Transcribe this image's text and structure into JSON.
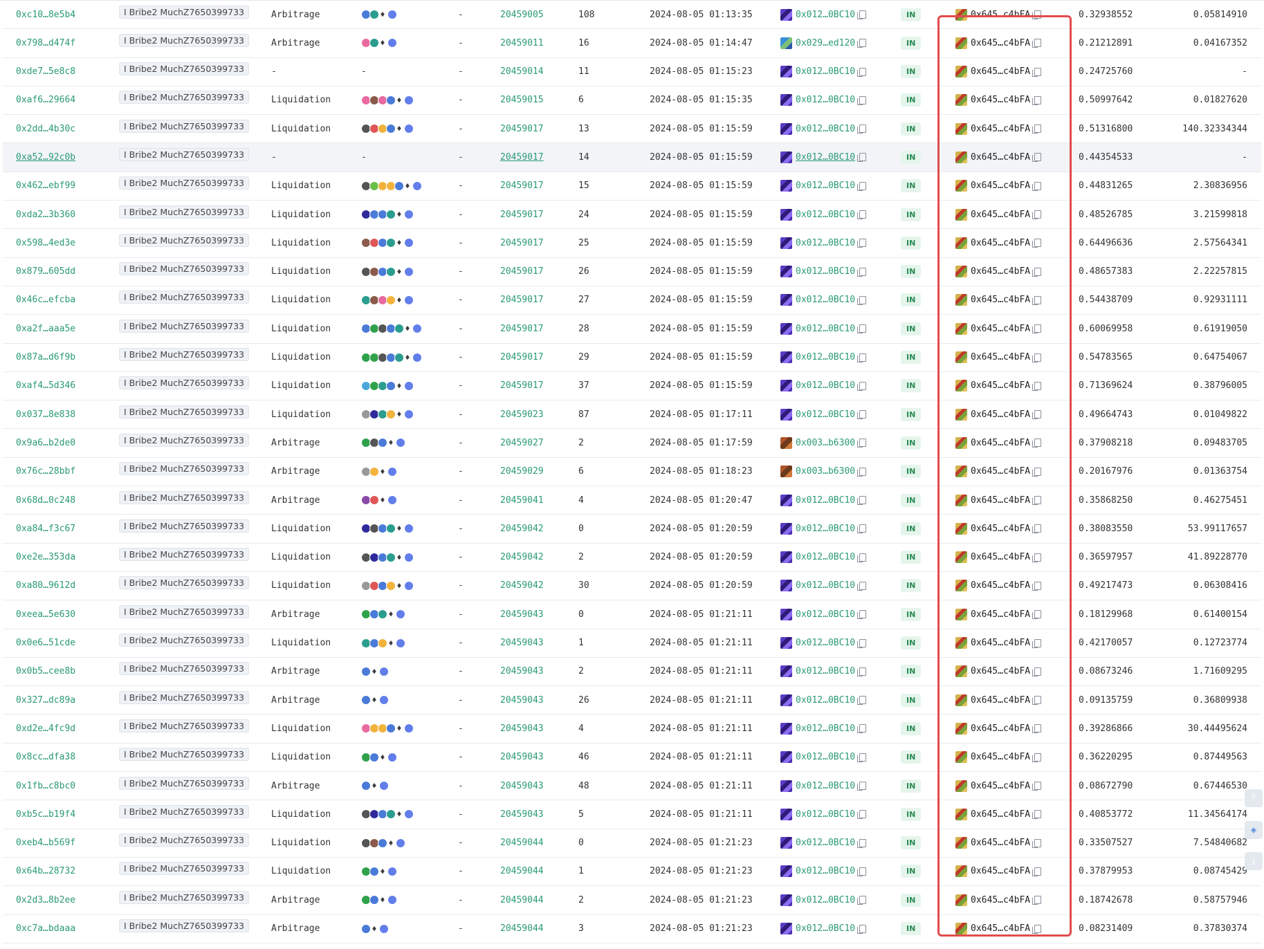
{
  "table": {
    "rows": [
      {
        "hash": "0xc10…8e5b4",
        "tag": "I Bribe2 MuchZ7650399733",
        "type": "Arbitrage",
        "tokens": [
          "#4a7bd8",
          "#2a9d8f",
          "eth",
          "#627eea"
        ],
        "dash": "-",
        "block": "20459005",
        "pos": "108",
        "time": "2024-08-05 01:13:35",
        "from": "0x012…0BC10",
        "from_avatar": "purple",
        "dir": "IN",
        "to": "0x645…c4bFA",
        "value1": "0.32938552",
        "value2": "0.05814910"
      },
      {
        "hash": "0x798…d474f",
        "tag": "I Bribe2 MuchZ7650399733",
        "type": "Arbitrage",
        "tokens": [
          "#e86aa0",
          "#2a9d8f",
          "eth",
          "#627eea"
        ],
        "dash": "-",
        "block": "20459011",
        "pos": "16",
        "time": "2024-08-05 01:14:47",
        "from": "0x029…ed120",
        "from_avatar": "blue",
        "dir": "IN",
        "to": "0x645…c4bFA",
        "value1": "0.21212891",
        "value2": "0.04167352"
      },
      {
        "hash": "0xde7…5e8c8",
        "tag": "I Bribe2 MuchZ7650399733",
        "type": "-",
        "tokens": [],
        "tokens_dash": "-",
        "dash": "-",
        "block": "20459014",
        "pos": "11",
        "time": "2024-08-05 01:15:23",
        "from": "0x012…0BC10",
        "from_avatar": "purple",
        "dir": "IN",
        "to": "0x645…c4bFA",
        "value1": "0.24725760",
        "value2": "-"
      },
      {
        "hash": "0xaf6…29664",
        "tag": "I Bribe2 MuchZ7650399733",
        "type": "Liquidation",
        "tokens": [
          "#e86aa0",
          "#8b5a4a",
          "#e86aa0",
          "#4a7bd8",
          "eth",
          "#627eea"
        ],
        "dash": "-",
        "block": "20459015",
        "pos": "6",
        "time": "2024-08-05 01:15:35",
        "from": "0x012…0BC10",
        "from_avatar": "purple",
        "dir": "IN",
        "to": "0x645…c4bFA",
        "value1": "0.50997642",
        "value2": "0.01827620"
      },
      {
        "hash": "0x2dd…4b30c",
        "tag": "I Bribe2 MuchZ7650399733",
        "type": "Liquidation",
        "tokens": [
          "#555",
          "#e05555",
          "#f2b33d",
          "#4a7bd8",
          "eth",
          "#627eea"
        ],
        "dash": "-",
        "block": "20459017",
        "pos": "13",
        "time": "2024-08-05 01:15:59",
        "from": "0x012…0BC10",
        "from_avatar": "purple",
        "dir": "IN",
        "to": "0x645…c4bFA",
        "value1": "0.51316800",
        "value2": "140.32334344"
      },
      {
        "hash": "0xa52…92c0b",
        "tag": "I Bribe2 MuchZ7650399733",
        "type": "-",
        "tokens": [],
        "tokens_dash": "-",
        "dash": "-",
        "block": "20459017",
        "pos": "14",
        "time": "2024-08-05 01:15:59",
        "from": "0x012…0BC10",
        "from_avatar": "purple",
        "dir": "IN",
        "to": "0x645…c4bFA",
        "value1": "0.44354533",
        "value2": "-",
        "hover": true
      },
      {
        "hash": "0x462…ebf99",
        "tag": "I Bribe2 MuchZ7650399733",
        "type": "Liquidation",
        "tokens": [
          "#555",
          "#6cbf4a",
          "#f2b33d",
          "#f2b33d",
          "#4a7bd8",
          "eth",
          "#627eea"
        ],
        "dash": "-",
        "block": "20459017",
        "pos": "15",
        "time": "2024-08-05 01:15:59",
        "from": "0x012…0BC10",
        "from_avatar": "purple",
        "dir": "IN",
        "to": "0x645…c4bFA",
        "value1": "0.44831265",
        "value2": "2.30836956"
      },
      {
        "hash": "0xda2…3b360",
        "tag": "I Bribe2 MuchZ7650399733",
        "type": "Liquidation",
        "tokens": [
          "#2e2a9c",
          "#4a7bd8",
          "#4a7bd8",
          "#2a9d8f",
          "eth",
          "#627eea"
        ],
        "dash": "-",
        "block": "20459017",
        "pos": "24",
        "time": "2024-08-05 01:15:59",
        "from": "0x012…0BC10",
        "from_avatar": "purple",
        "dir": "IN",
        "to": "0x645…c4bFA",
        "value1": "0.48526785",
        "value2": "3.21599818"
      },
      {
        "hash": "0x598…4ed3e",
        "tag": "I Bribe2 MuchZ7650399733",
        "type": "Liquidation",
        "tokens": [
          "#8b5a4a",
          "#e05555",
          "#4a7bd8",
          "#2a9d8f",
          "eth",
          "#627eea"
        ],
        "dash": "-",
        "block": "20459017",
        "pos": "25",
        "time": "2024-08-05 01:15:59",
        "from": "0x012…0BC10",
        "from_avatar": "purple",
        "dir": "IN",
        "to": "0x645…c4bFA",
        "value1": "0.64496636",
        "value2": "2.57564341"
      },
      {
        "hash": "0x879…605dd",
        "tag": "I Bribe2 MuchZ7650399733",
        "type": "Liquidation",
        "tokens": [
          "#555",
          "#8b5a4a",
          "#4a7bd8",
          "#2a9d8f",
          "eth",
          "#627eea"
        ],
        "dash": "-",
        "block": "20459017",
        "pos": "26",
        "time": "2024-08-05 01:15:59",
        "from": "0x012…0BC10",
        "from_avatar": "purple",
        "dir": "IN",
        "to": "0x645…c4bFA",
        "value1": "0.48657383",
        "value2": "2.22257815"
      },
      {
        "hash": "0x46c…efcba",
        "tag": "I Bribe2 MuchZ7650399733",
        "type": "Liquidation",
        "tokens": [
          "#2a9d8f",
          "#8b5a4a",
          "#e86aa0",
          "#f2b33d",
          "eth",
          "#627eea"
        ],
        "dash": "-",
        "block": "20459017",
        "pos": "27",
        "time": "2024-08-05 01:15:59",
        "from": "0x012…0BC10",
        "from_avatar": "purple",
        "dir": "IN",
        "to": "0x645…c4bFA",
        "value1": "0.54438709",
        "value2": "0.92931111"
      },
      {
        "hash": "0xa2f…aaa5e",
        "tag": "I Bribe2 MuchZ7650399733",
        "type": "Liquidation",
        "tokens": [
          "#4a7bd8",
          "#2fa14a",
          "#555",
          "#4a7bd8",
          "#2a9d8f",
          "eth",
          "#627eea"
        ],
        "dash": "-",
        "block": "20459017",
        "pos": "28",
        "time": "2024-08-05 01:15:59",
        "from": "0x012…0BC10",
        "from_avatar": "purple",
        "dir": "IN",
        "to": "0x645…c4bFA",
        "value1": "0.60069958",
        "value2": "0.61919050"
      },
      {
        "hash": "0x87a…d6f9b",
        "tag": "I Bribe2 MuchZ7650399733",
        "type": "Liquidation",
        "tokens": [
          "#2fa14a",
          "#2fa14a",
          "#555",
          "#4a7bd8",
          "#2a9d8f",
          "eth",
          "#627eea"
        ],
        "dash": "-",
        "block": "20459017",
        "pos": "29",
        "time": "2024-08-05 01:15:59",
        "from": "0x012…0BC10",
        "from_avatar": "purple",
        "dir": "IN",
        "to": "0x645…c4bFA",
        "value1": "0.54783565",
        "value2": "0.64754067"
      },
      {
        "hash": "0xaf4…5d346",
        "tag": "I Bribe2 MuchZ7650399733",
        "type": "Liquidation",
        "tokens": [
          "#4aa8d8",
          "#2fa14a",
          "#2a9d8f",
          "#4a7bd8",
          "eth",
          "#627eea"
        ],
        "dash": "-",
        "block": "20459017",
        "pos": "37",
        "time": "2024-08-05 01:15:59",
        "from": "0x012…0BC10",
        "from_avatar": "purple",
        "dir": "IN",
        "to": "0x645…c4bFA",
        "value1": "0.71369624",
        "value2": "0.38796005"
      },
      {
        "hash": "0x037…8e838",
        "tag": "I Bribe2 MuchZ7650399733",
        "type": "Liquidation",
        "tokens": [
          "#999",
          "#2e2a9c",
          "#2a9d8f",
          "#f2b33d",
          "eth",
          "#627eea"
        ],
        "dash": "-",
        "block": "20459023",
        "pos": "87",
        "time": "2024-08-05 01:17:11",
        "from": "0x012…0BC10",
        "from_avatar": "purple",
        "dir": "IN",
        "to": "0x645…c4bFA",
        "value1": "0.49664743",
        "value2": "0.01049822"
      },
      {
        "hash": "0x9a6…b2de0",
        "tag": "I Bribe2 MuchZ7650399733",
        "type": "Arbitrage",
        "tokens": [
          "#2fa14a",
          "#555",
          "#4a7bd8",
          "eth",
          "#627eea"
        ],
        "dash": "-",
        "block": "20459027",
        "pos": "2",
        "time": "2024-08-05 01:17:59",
        "from": "0x003…b6300",
        "from_avatar": "brown",
        "dir": "IN",
        "to": "0x645…c4bFA",
        "value1": "0.37908218",
        "value2": "0.09483705"
      },
      {
        "hash": "0x76c…28bbf",
        "tag": "I Bribe2 MuchZ7650399733",
        "type": "Arbitrage",
        "tokens": [
          "#999",
          "#f2b33d",
          "eth",
          "#627eea"
        ],
        "dash": "-",
        "block": "20459029",
        "pos": "6",
        "time": "2024-08-05 01:18:23",
        "from": "0x003…b6300",
        "from_avatar": "brown",
        "dir": "IN",
        "to": "0x645…c4bFA",
        "value1": "0.20167976",
        "value2": "0.01363754"
      },
      {
        "hash": "0x68d…0c248",
        "tag": "I Bribe2 MuchZ7650399733",
        "type": "Arbitrage",
        "tokens": [
          "#8a4aa8",
          "#e05555",
          "eth",
          "#627eea"
        ],
        "dash": "-",
        "block": "20459041",
        "pos": "4",
        "time": "2024-08-05 01:20:47",
        "from": "0x012…0BC10",
        "from_avatar": "purple",
        "dir": "IN",
        "to": "0x645…c4bFA",
        "value1": "0.35868250",
        "value2": "0.46275451"
      },
      {
        "hash": "0xa84…f3c67",
        "tag": "I Bribe2 MuchZ7650399733",
        "type": "Liquidation",
        "tokens": [
          "#2e2a9c",
          "#555",
          "#4a7bd8",
          "#2a9d8f",
          "eth",
          "#627eea"
        ],
        "dash": "-",
        "block": "20459042",
        "pos": "0",
        "time": "2024-08-05 01:20:59",
        "from": "0x012…0BC10",
        "from_avatar": "purple",
        "dir": "IN",
        "to": "0x645…c4bFA",
        "value1": "0.38083550",
        "value2": "53.99117657"
      },
      {
        "hash": "0xe2e…353da",
        "tag": "I Bribe2 MuchZ7650399733",
        "type": "Liquidation",
        "tokens": [
          "#555",
          "#2e2a9c",
          "#4a7bd8",
          "#2a9d8f",
          "eth",
          "#627eea"
        ],
        "dash": "-",
        "block": "20459042",
        "pos": "2",
        "time": "2024-08-05 01:20:59",
        "from": "0x012…0BC10",
        "from_avatar": "purple",
        "dir": "IN",
        "to": "0x645…c4bFA",
        "value1": "0.36597957",
        "value2": "41.89228770"
      },
      {
        "hash": "0xa80…9612d",
        "tag": "I Bribe2 MuchZ7650399733",
        "type": "Liquidation",
        "tokens": [
          "#999",
          "#e05555",
          "#4a7bd8",
          "#f2b33d",
          "eth",
          "#627eea"
        ],
        "dash": "-",
        "block": "20459042",
        "pos": "30",
        "time": "2024-08-05 01:20:59",
        "from": "0x012…0BC10",
        "from_avatar": "purple",
        "dir": "IN",
        "to": "0x645…c4bFA",
        "value1": "0.49217473",
        "value2": "0.06308416"
      },
      {
        "hash": "0xeea…5e630",
        "tag": "I Bribe2 MuchZ7650399733",
        "type": "Arbitrage",
        "tokens": [
          "#2fa14a",
          "#4a7bd8",
          "#2a9d8f",
          "eth",
          "#627eea"
        ],
        "dash": "-",
        "block": "20459043",
        "pos": "0",
        "time": "2024-08-05 01:21:11",
        "from": "0x012…0BC10",
        "from_avatar": "purple",
        "dir": "IN",
        "to": "0x645…c4bFA",
        "value1": "0.18129968",
        "value2": "0.61400154"
      },
      {
        "hash": "0x0e6…51cde",
        "tag": "I Bribe2 MuchZ7650399733",
        "type": "Liquidation",
        "tokens": [
          "#2a9d8f",
          "#4a7bd8",
          "#f2b33d",
          "eth",
          "#627eea"
        ],
        "dash": "-",
        "block": "20459043",
        "pos": "1",
        "time": "2024-08-05 01:21:11",
        "from": "0x012…0BC10",
        "from_avatar": "purple",
        "dir": "IN",
        "to": "0x645…c4bFA",
        "value1": "0.42170057",
        "value2": "0.12723774"
      },
      {
        "hash": "0x0b5…cee8b",
        "tag": "I Bribe2 MuchZ7650399733",
        "type": "Arbitrage",
        "tokens": [
          "#4a7bd8",
          "eth",
          "#627eea"
        ],
        "dash": "-",
        "block": "20459043",
        "pos": "2",
        "time": "2024-08-05 01:21:11",
        "from": "0x012…0BC10",
        "from_avatar": "purple",
        "dir": "IN",
        "to": "0x645…c4bFA",
        "value1": "0.08673246",
        "value2": "1.71609295"
      },
      {
        "hash": "0x327…dc89a",
        "tag": "I Bribe2 MuchZ7650399733",
        "type": "Arbitrage",
        "tokens": [
          "#4a7bd8",
          "eth",
          "#627eea"
        ],
        "dash": "-",
        "block": "20459043",
        "pos": "26",
        "time": "2024-08-05 01:21:11",
        "from": "0x012…0BC10",
        "from_avatar": "purple",
        "dir": "IN",
        "to": "0x645…c4bFA",
        "value1": "0.09135759",
        "value2": "0.36809938"
      },
      {
        "hash": "0xd2e…4fc9d",
        "tag": "I Bribe2 MuchZ7650399733",
        "type": "Liquidation",
        "tokens": [
          "#e86aa0",
          "#f2b33d",
          "#f2b33d",
          "#4a7bd8",
          "eth",
          "#627eea"
        ],
        "dash": "-",
        "block": "20459043",
        "pos": "4",
        "time": "2024-08-05 01:21:11",
        "from": "0x012…0BC10",
        "from_avatar": "purple",
        "dir": "IN",
        "to": "0x645…c4bFA",
        "value1": "0.39286866",
        "value2": "30.44495624"
      },
      {
        "hash": "0x8cc…dfa38",
        "tag": "I Bribe2 MuchZ7650399733",
        "type": "Liquidation",
        "tokens": [
          "#2fa14a",
          "#4a7bd8",
          "eth",
          "#627eea"
        ],
        "dash": "-",
        "block": "20459043",
        "pos": "46",
        "time": "2024-08-05 01:21:11",
        "from": "0x012…0BC10",
        "from_avatar": "purple",
        "dir": "IN",
        "to": "0x645…c4bFA",
        "value1": "0.36220295",
        "value2": "0.87449563"
      },
      {
        "hash": "0x1fb…c8bc0",
        "tag": "I Bribe2 MuchZ7650399733",
        "type": "Arbitrage",
        "tokens": [
          "#4a7bd8",
          "eth",
          "#627eea"
        ],
        "dash": "-",
        "block": "20459043",
        "pos": "48",
        "time": "2024-08-05 01:21:11",
        "from": "0x012…0BC10",
        "from_avatar": "purple",
        "dir": "IN",
        "to": "0x645…c4bFA",
        "value1": "0.08672790",
        "value2": "0.67446530"
      },
      {
        "hash": "0xb5c…b19f4",
        "tag": "I Bribe2 MuchZ7650399733",
        "type": "Liquidation",
        "tokens": [
          "#555",
          "#2e2a9c",
          "#4a7bd8",
          "#2a9d8f",
          "eth",
          "#627eea"
        ],
        "dash": "-",
        "block": "20459043",
        "pos": "5",
        "time": "2024-08-05 01:21:11",
        "from": "0x012…0BC10",
        "from_avatar": "purple",
        "dir": "IN",
        "to": "0x645…c4bFA",
        "value1": "0.40853772",
        "value2": "11.34564174"
      },
      {
        "hash": "0xeb4…b569f",
        "tag": "I Bribe2 MuchZ7650399733",
        "type": "Liquidation",
        "tokens": [
          "#555",
          "#8b5a4a",
          "#4a7bd8",
          "eth",
          "#627eea"
        ],
        "dash": "-",
        "block": "20459044",
        "pos": "0",
        "time": "2024-08-05 01:21:23",
        "from": "0x012…0BC10",
        "from_avatar": "purple",
        "dir": "IN",
        "to": "0x645…c4bFA",
        "value1": "0.33507527",
        "value2": "7.54840682"
      },
      {
        "hash": "0x64b…28732",
        "tag": "I Bribe2 MuchZ7650399733",
        "type": "Liquidation",
        "tokens": [
          "#2fa14a",
          "#4a7bd8",
          "eth",
          "#627eea"
        ],
        "dash": "-",
        "block": "20459044",
        "pos": "1",
        "time": "2024-08-05 01:21:23",
        "from": "0x012…0BC10",
        "from_avatar": "purple",
        "dir": "IN",
        "to": "0x645…c4bFA",
        "value1": "0.37879953",
        "value2": "0.08745429"
      },
      {
        "hash": "0x2d3…8b2ee",
        "tag": "I Bribe2 MuchZ7650399733",
        "type": "Arbitrage",
        "tokens": [
          "#2fa14a",
          "#4a7bd8",
          "eth",
          "#627eea"
        ],
        "dash": "-",
        "block": "20459044",
        "pos": "2",
        "time": "2024-08-05 01:21:23",
        "from": "0x012…0BC10",
        "from_avatar": "purple",
        "dir": "IN",
        "to": "0x645…c4bFA",
        "value1": "0.18742678",
        "value2": "0.58757946"
      },
      {
        "hash": "0xc7a…bdaaa",
        "tag": "I Bribe2 MuchZ7650399733",
        "type": "Arbitrage",
        "tokens": [
          "#4a7bd8",
          "eth",
          "#627eea"
        ],
        "dash": "-",
        "block": "20459044",
        "pos": "3",
        "time": "2024-08-05 01:21:23",
        "from": "0x012…0BC10",
        "from_avatar": "purple",
        "dir": "IN",
        "to": "0x645…c4bFA",
        "value1": "0.08231409",
        "value2": "0.37830374"
      }
    ]
  },
  "colors": {
    "link": "#2a9a74",
    "highlight_border": "#e24b4b",
    "badge_bg": "#e6f5ec",
    "badge_text": "#2b8a55"
  },
  "icons": {
    "copy": "copy-icon",
    "scroll_top": "arrow-up-icon",
    "view": "eye-icon",
    "scroll_bottom": "arrow-down-icon"
  }
}
